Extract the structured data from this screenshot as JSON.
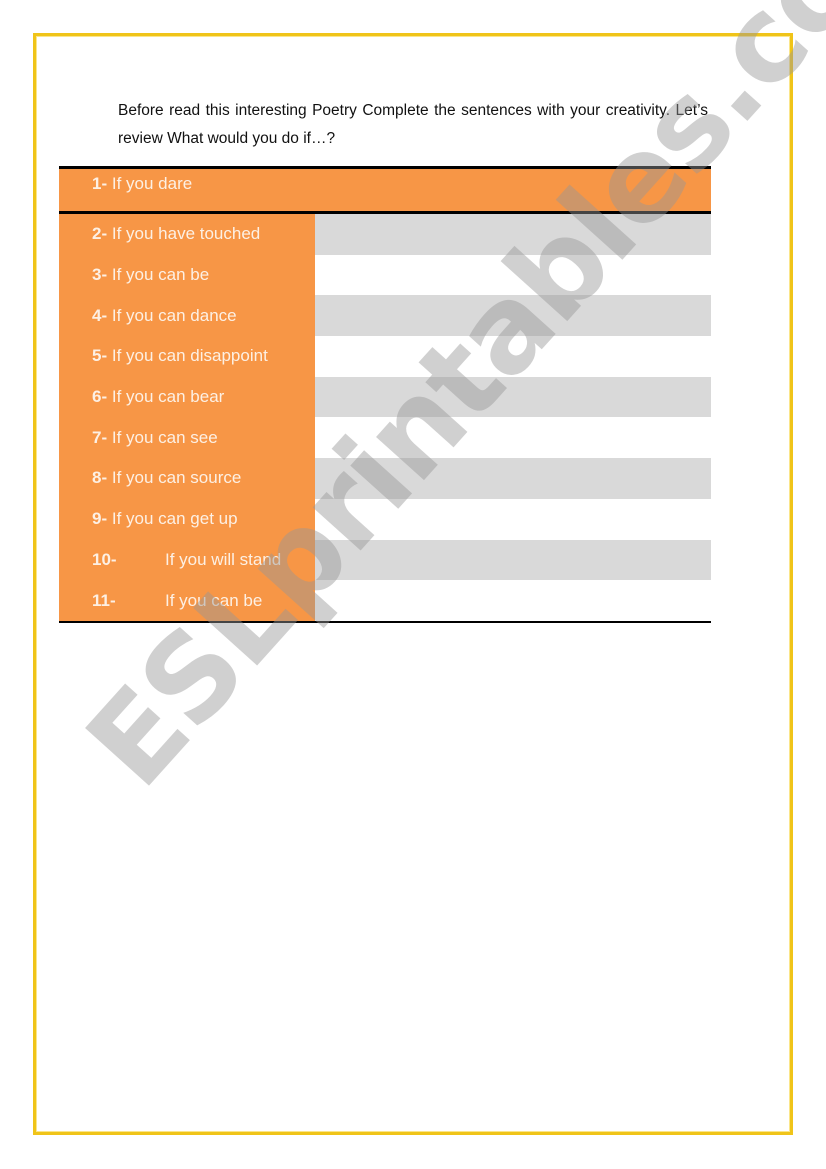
{
  "intro_text": "Before read this interesting Poetry Complete the sentences with your creativity. Let’s review What would you do if…?",
  "items": [
    {
      "number": "1-",
      "text": "If you dare"
    },
    {
      "number": "2-",
      "text": "If you have touched"
    },
    {
      "number": "3-",
      "text": "If you can be"
    },
    {
      "number": "4-",
      "text": "If you can dance"
    },
    {
      "number": "5-",
      "text": "If you can disappoint"
    },
    {
      "number": "6-",
      "text": "If you can bear"
    },
    {
      "number": "7-",
      "text": "If you can see"
    },
    {
      "number": "8-",
      "text": "If you can source"
    },
    {
      "number": "9-",
      "text": "If you can get up"
    },
    {
      "number": "10-",
      "text": "If you will stand"
    },
    {
      "number": "11-",
      "text": "If you can be"
    }
  ],
  "watermark": "ESLprintables.com",
  "colors": {
    "border": "#f0c419",
    "orange": "#f79646",
    "gray_band": "#d9d9d9"
  }
}
